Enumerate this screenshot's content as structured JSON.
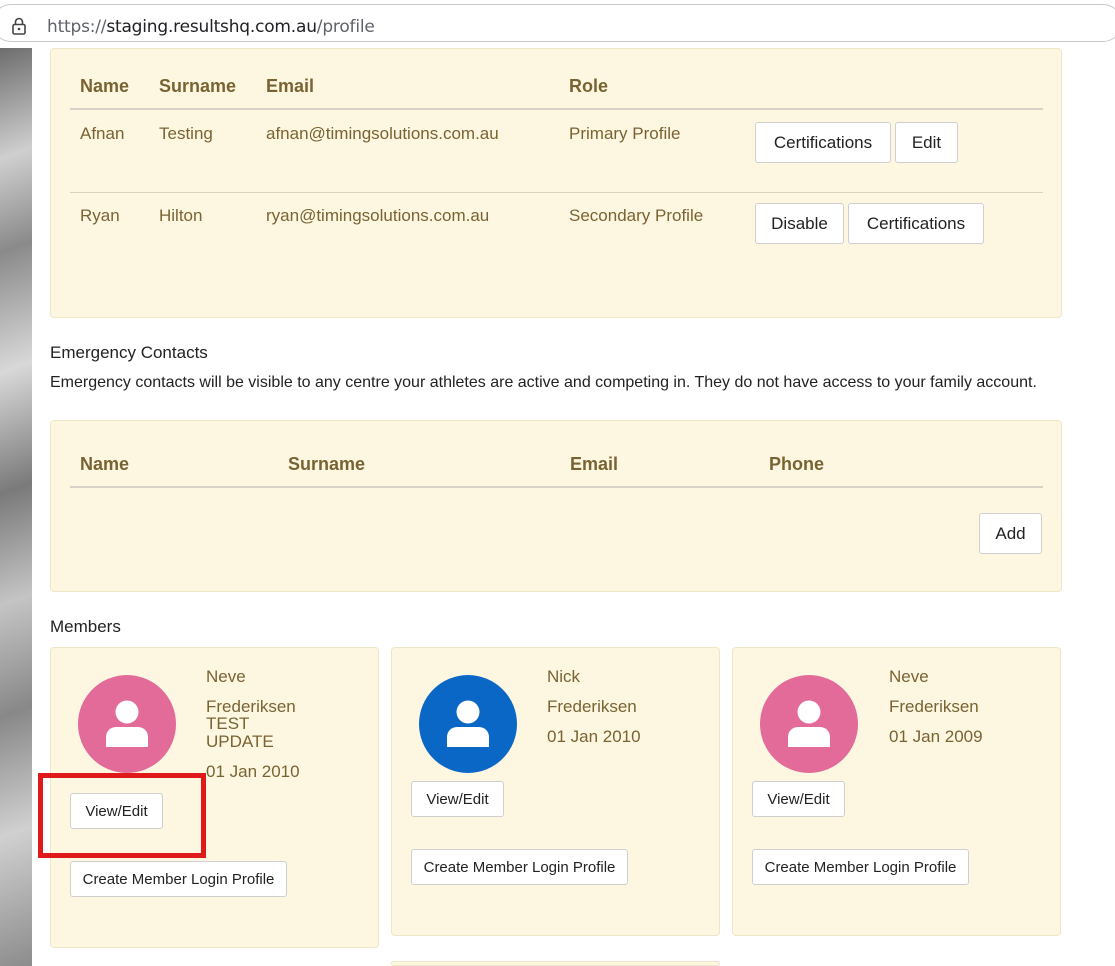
{
  "browser": {
    "url_scheme": "https://",
    "url_host": "staging.resultshq.com.au",
    "url_path": "/profile"
  },
  "profiles": {
    "headers": [
      "Name",
      "Surname",
      "Email",
      "Role"
    ],
    "rows": [
      {
        "name": "Afnan",
        "surname": "Testing",
        "email": "afnan@timingsolutions.com.au",
        "role": "Primary Profile",
        "actions": [
          "Certifications",
          "Edit"
        ]
      },
      {
        "name": "Ryan",
        "surname": "Hilton",
        "email": "ryan@timingsolutions.com.au",
        "role": "Secondary Profile",
        "actions": [
          "Disable",
          "Certifications"
        ]
      }
    ]
  },
  "emergency": {
    "title": "Emergency Contacts",
    "description": "Emergency contacts will be visible to any centre your athletes are active and competing in. They do not have access to your family account.",
    "headers": [
      "Name",
      "Surname",
      "Email",
      "Phone"
    ],
    "add_label": "Add"
  },
  "members": {
    "title": "Members",
    "view_edit_label": "View/Edit",
    "create_login_label": "Create Member Login Profile",
    "cards": [
      {
        "first": "Neve",
        "last_lines": [
          "Frederiksen",
          "TEST",
          "UPDATE"
        ],
        "dob": "01 Jan 2010",
        "avatar_color": "#e36b99"
      },
      {
        "first": "Nick",
        "last_lines": [
          "Frederiksen"
        ],
        "dob": "01 Jan 2010",
        "avatar_color": "#0a67c6"
      },
      {
        "first": "Neve",
        "last_lines": [
          "Frederiksen"
        ],
        "dob": "01 Jan 2009",
        "avatar_color": "#e36b99"
      }
    ]
  },
  "colors": {
    "panel_bg": "#fdf7e2",
    "header_text": "#7a6332",
    "highlight": "#e0191b"
  }
}
